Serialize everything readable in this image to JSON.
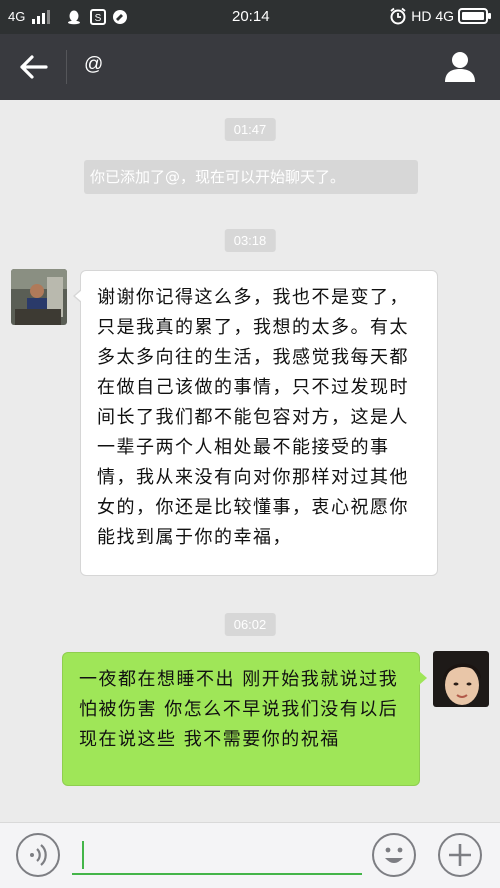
{
  "status_bar": {
    "network": "4G",
    "time": "20:14",
    "right_label": "HD 4G",
    "icons": [
      "signal-icon",
      "qq-icon",
      "sohu-icon",
      "browser-icon",
      "alarm-icon",
      "battery-icon"
    ]
  },
  "header": {
    "title": "@",
    "icons": [
      "back-arrow-icon",
      "profile-icon"
    ]
  },
  "messages": {
    "ts1": "01:47",
    "system": "你已添加了@，现在可以开始聊天了。",
    "ts2": "03:18",
    "incoming": "谢谢你记得这么多，我也不是变了，只是我真的累了，我想的太多。有太多太多向往的生活，我感觉我每天都在做自己该做的事情，只不过发现时间长了我们都不能包容对方，这是人一辈子两个人相处最不能接受的事情，我从来没有向对你那样对过其他女的，你还是比较懂事，衷心祝愿你能找到属于你的幸福，",
    "ts3": "06:02",
    "outgoing": "一夜都在想睡不出 刚开始我就说过我怕被伤害 你怎么不早说我们没有以后 现在说这些 我不需要你的祝福"
  },
  "input_bar": {
    "value": "",
    "icons": [
      "voice-icon",
      "emoji-icon",
      "plus-icon"
    ]
  },
  "colors": {
    "status_bg": "#2e3132",
    "header_bg": "#393a3f",
    "chat_bg": "#ebebeb",
    "outgoing_bubble": "#9fe658",
    "incoming_bubble": "#ffffff",
    "accent_green": "#44b549"
  }
}
